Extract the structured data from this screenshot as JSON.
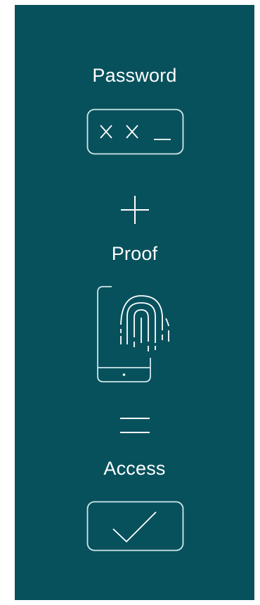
{
  "steps": {
    "password_label": "Password",
    "proof_label": "Proof",
    "access_label": "Access"
  },
  "icons": {
    "password_field": "password-field-icon",
    "plus": "plus-icon",
    "fingerprint_phone": "fingerprint-phone-icon",
    "equals": "equals-icon",
    "checkmark_box": "checkmark-box-icon"
  },
  "colors": {
    "panel_background": "#07515d",
    "foreground": "#ffffff",
    "icon_stroke": "#cfe7ea"
  }
}
